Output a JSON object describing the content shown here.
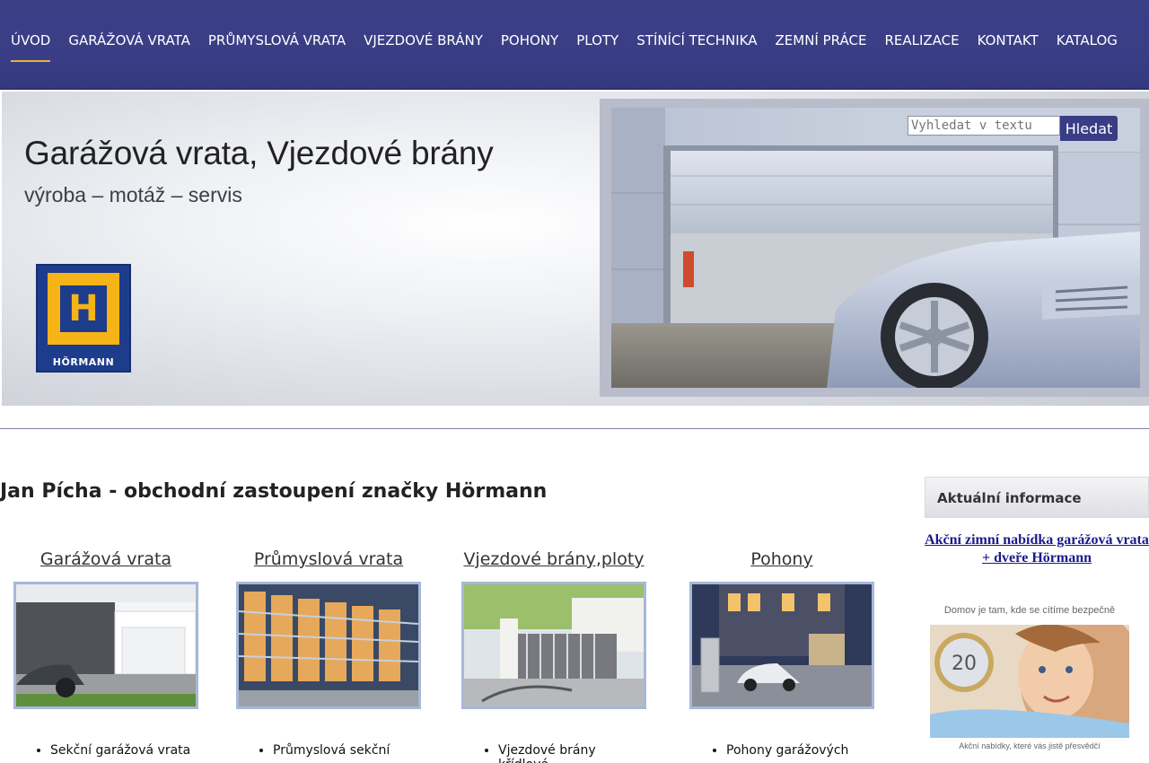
{
  "nav": {
    "items": [
      "ÚVOD",
      "GARÁŽOVÁ VRATA",
      "PRŮMYSLOVÁ VRATA",
      "VJEZDOVÉ BRÁNY",
      "POHONY",
      "PLOTY",
      "STÍNÍCÍ TECHNIKA",
      "ZEMNÍ PRÁCE",
      "REALIZACE",
      "KONTAKT",
      "KATALOG"
    ],
    "active_index": 0
  },
  "hero": {
    "title": "Garážová vrata, Vjezdové brány",
    "subtitle": "výroba – motáž – servis",
    "logo_text": "HÖRMANN"
  },
  "search": {
    "placeholder": "Vyhledat v textu",
    "button_label": "Hledat"
  },
  "main": {
    "title": "Jan Pícha - obchodní zastoupení značky Hörmann",
    "categories": [
      {
        "title": "Garážová vrata",
        "bullet": "Sekční garážová vrata"
      },
      {
        "title": "Průmyslová vrata",
        "bullet": "Průmyslová sekční"
      },
      {
        "title": "Vjezdové brány,ploty",
        "bullet": "Vjezdové brány křídlové"
      },
      {
        "title": "Pohony",
        "bullet": "Pohony garážových"
      }
    ]
  },
  "sidebar": {
    "heading": "Aktuální informace",
    "link": "Akční zimní nabídka garážová vrata + dveře Hörmann",
    "promo_caption": "Domov je tam, kde se cítíme bezpečně",
    "promo_footer": "Akční nabídky, které vás jistě přesvědčí"
  },
  "colors": {
    "nav_bg": "#393d85",
    "active_underline": "#e8b03c",
    "logo_blue": "#1e3c8c",
    "logo_yellow": "#f6b418",
    "link_blue": "#1a1a8c"
  }
}
